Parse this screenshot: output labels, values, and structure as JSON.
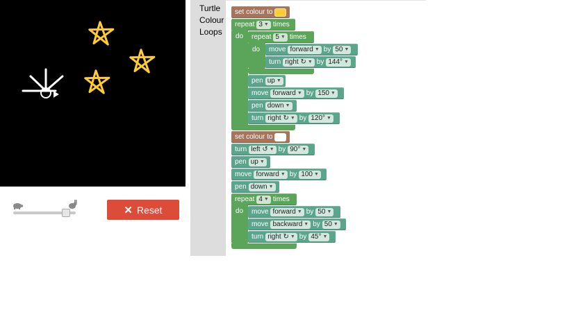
{
  "toolbox": {
    "categories": [
      "Turtle",
      "Colour",
      "Loops"
    ]
  },
  "controls": {
    "reset_label": "Reset",
    "speed_level": 0.9
  },
  "colors": {
    "set1": "#ffcc33",
    "set2": "#ffffff",
    "star": "#ffcc33",
    "loop": "#5ba55b",
    "turtle": "#5ba58c",
    "colour": "#a5745b",
    "reset": "#dd4b39"
  },
  "blocks": {
    "set_colour_label": "set colour to",
    "repeat_label": "repeat",
    "times_label": "times",
    "do_label": "do",
    "move_label": "move",
    "by_label": "by",
    "turn_label": "turn",
    "pen_label": "pen",
    "r1_count": "3",
    "r2_count": "5",
    "r3_count": "4",
    "forward": "forward",
    "backward": "backward",
    "right": "right ↻",
    "left": "left ↺",
    "up": "up",
    "down": "down",
    "v50": "50",
    "v150": "150",
    "v100": "100",
    "a144": "144°",
    "a120": "120°",
    "a90": "90°",
    "a45": "45°"
  }
}
